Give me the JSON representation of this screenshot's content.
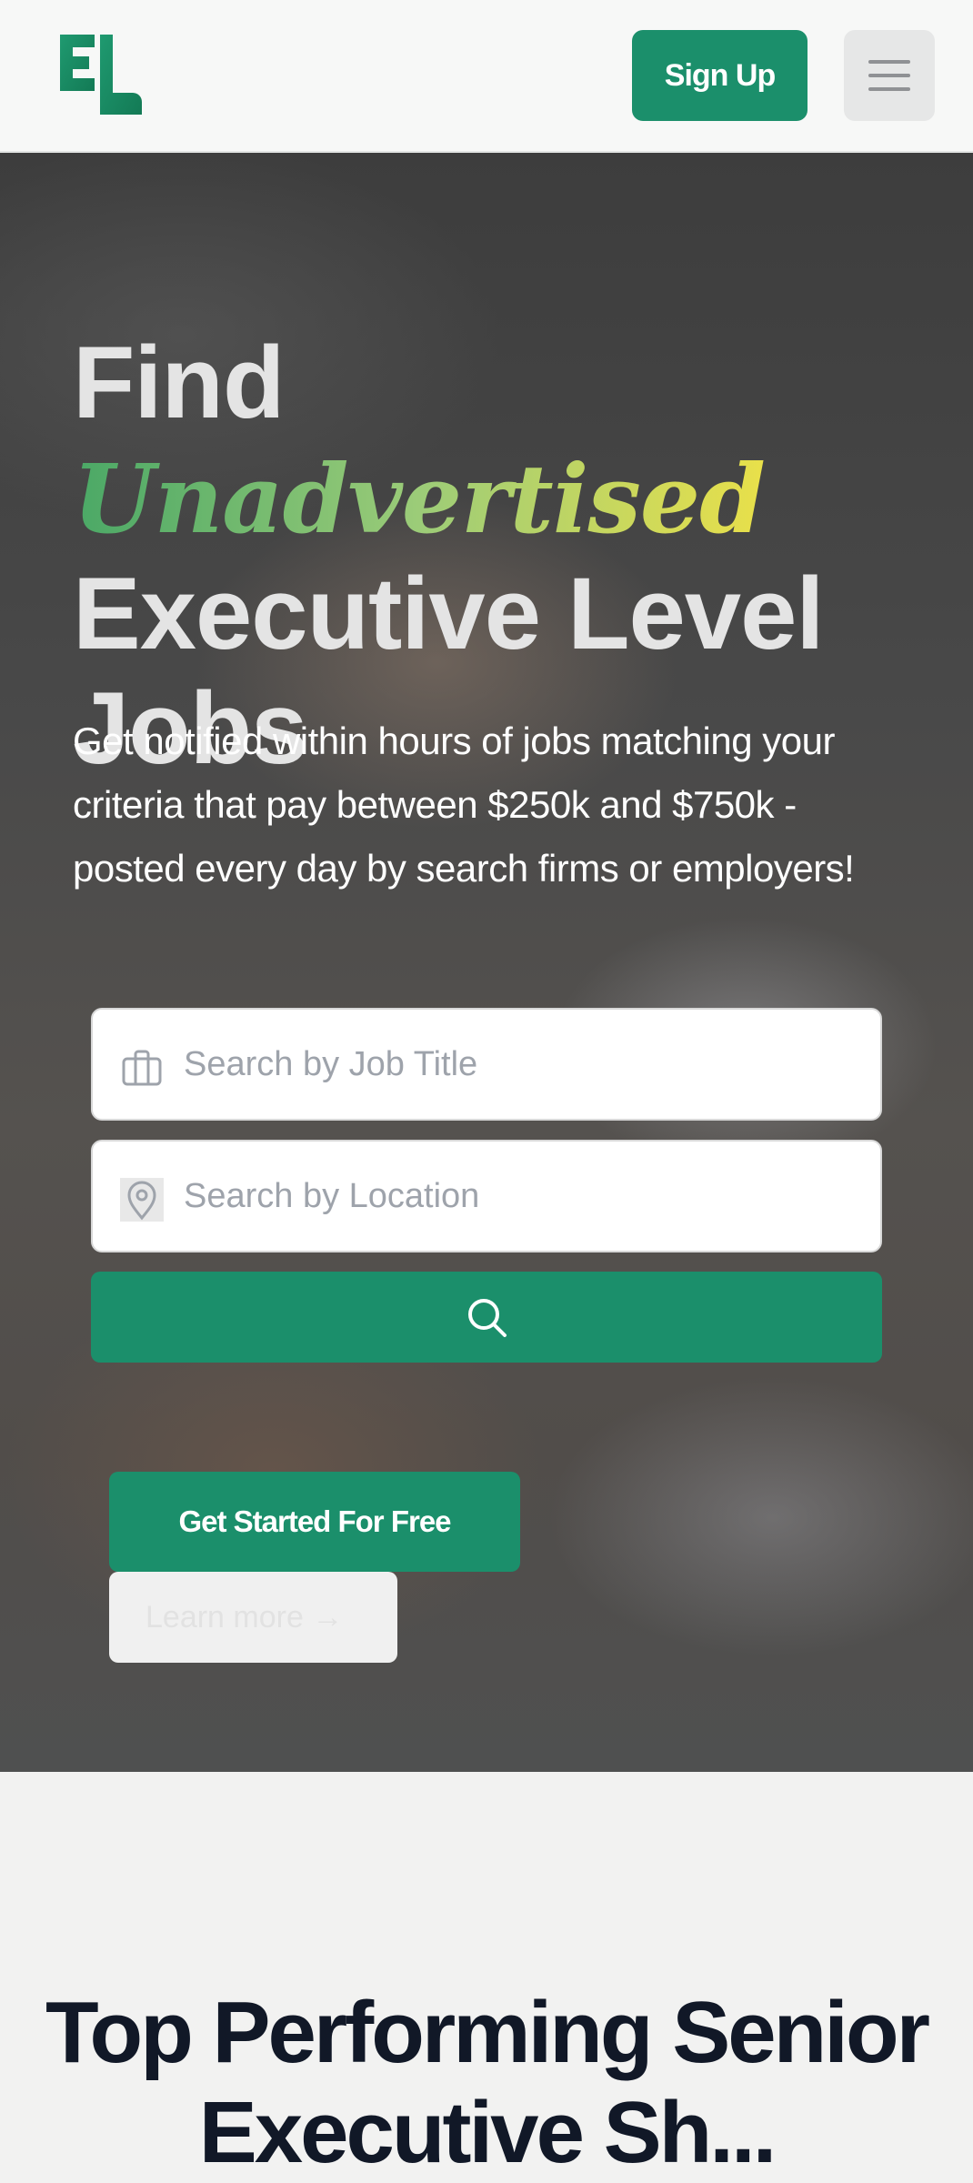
{
  "header": {
    "logo_alt": "EL",
    "signup_label": "Sign Up",
    "brand_color": "#1b8f6b"
  },
  "hero": {
    "title_prefix": "Find ",
    "title_accent": "Unadvertised",
    "title_suffix": " Executive Level Jobs",
    "subtitle": "Get notified within hours of jobs matching your criteria that pay between $250k and $750k - posted every day by search firms or employers!",
    "search": {
      "job_title_placeholder": "Search by Job Title",
      "location_placeholder": "Search by Location",
      "button_icon": "search-icon"
    },
    "cta_label": "Get Started For Free",
    "learn_more_label": "Learn more →"
  },
  "section": {
    "title": "Top Performing Senior Executive Sh..."
  }
}
